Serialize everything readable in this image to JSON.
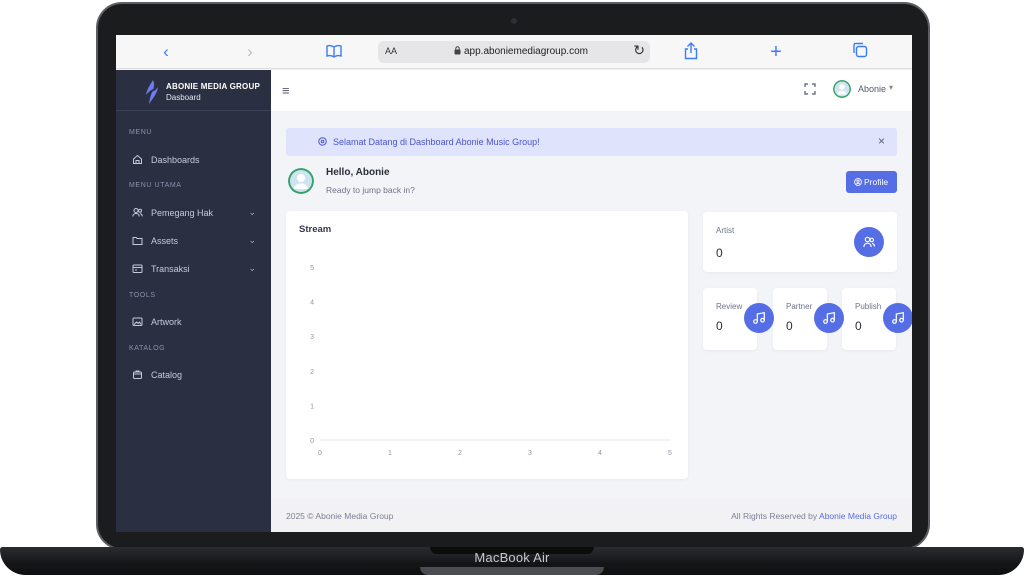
{
  "device": {
    "label": "MacBook Air"
  },
  "browser": {
    "text_size_label": "AA",
    "url": "app.aboniemediagroup.com"
  },
  "brand": {
    "name": "ABONIE MEDIA GROUP",
    "subtitle": "Dasboard"
  },
  "sidebar": {
    "sections": [
      {
        "title": "MENU"
      },
      {
        "title": "MENU UTAMA"
      },
      {
        "title": "TOOLS"
      },
      {
        "title": "KATALOG"
      }
    ],
    "items": [
      {
        "label": "Dashboards",
        "icon": "home-icon"
      },
      {
        "label": "Pemegang Hak",
        "icon": "users-icon",
        "has_submenu": true
      },
      {
        "label": "Assets",
        "icon": "folder-icon",
        "has_submenu": true
      },
      {
        "label": "Transaksi",
        "icon": "receipt-icon",
        "has_submenu": true
      },
      {
        "label": "Artwork",
        "icon": "image-icon"
      },
      {
        "label": "Catalog",
        "icon": "shopping-bag-icon"
      }
    ]
  },
  "topbar": {
    "user_name": "Abonie"
  },
  "alert": {
    "message": "Selamat Datang di Dashboard Abonie Music Group!"
  },
  "greeting": {
    "title": "Hello, Abonie",
    "subtitle": "Ready to jump back in?",
    "profile_button": "Profile"
  },
  "stats": {
    "artist": {
      "label": "Artist",
      "value": "0"
    },
    "review": {
      "label": "Review",
      "value": "0"
    },
    "partner": {
      "label": "Partner",
      "value": "0"
    },
    "publish": {
      "label": "Publish",
      "value": "0"
    }
  },
  "chart_data": {
    "type": "line",
    "title": "Stream",
    "x": [],
    "series": [],
    "xlim": [
      0,
      5
    ],
    "ylim": [
      0,
      5
    ],
    "x_ticks": [
      "0",
      "1",
      "2",
      "3",
      "4",
      "5"
    ],
    "y_ticks": [
      "0",
      "1",
      "2",
      "3",
      "4",
      "5"
    ],
    "grid": false
  },
  "footer": {
    "copyright": "2025 © Abonie Media Group",
    "rights_prefix": "All Rights Reserved by",
    "rights_link": "Abonie Media Group"
  },
  "colors": {
    "primary": "#556ee6",
    "sidebar": "#2a3042",
    "alert_bg": "#dfe3fb"
  }
}
